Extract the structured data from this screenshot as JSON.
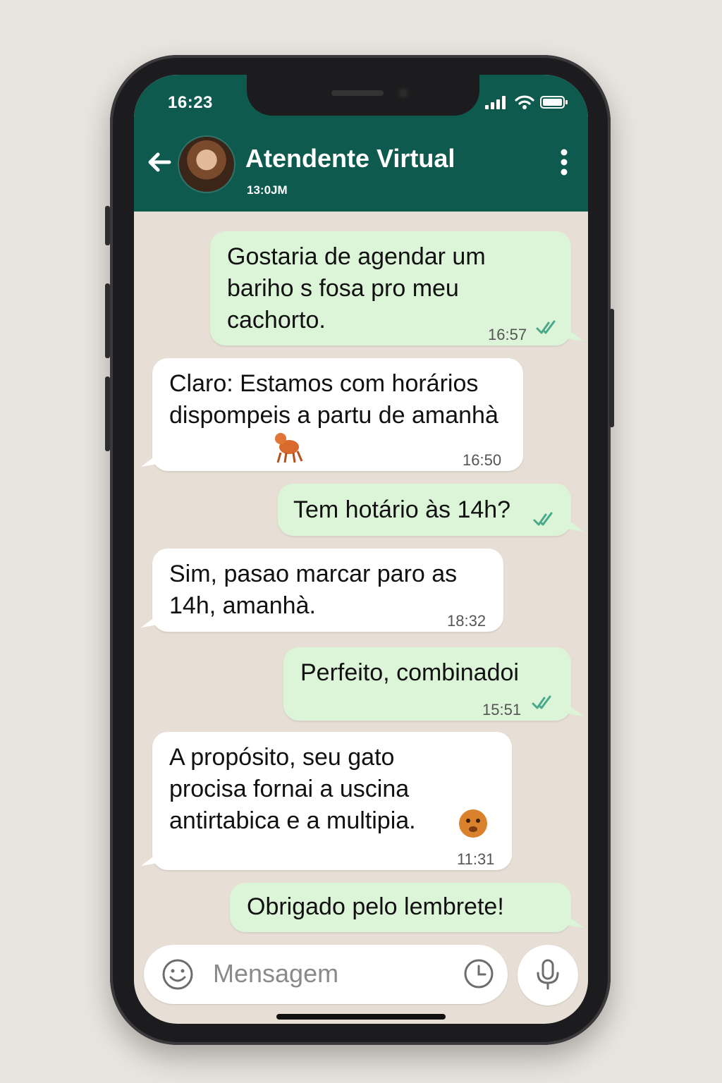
{
  "status_bar": {
    "time": "16:23"
  },
  "header": {
    "contact_name": "Atendente Virtual",
    "contact_status": "13:0JM"
  },
  "messages": [
    {
      "direction": "out",
      "text": "Gostaria de agendar um bariho s fosa pro meu cachorto.",
      "time": "16:57"
    },
    {
      "direction": "in",
      "text": "Claro: Estamos com horários dispompeis a partu de amanhà",
      "time": "16:50"
    },
    {
      "direction": "out",
      "text": "Tem hotário às 14h?",
      "time": ""
    },
    {
      "direction": "in",
      "text": "Sim, pasao marcar paro as 14h, amanhà.",
      "time": "18:32"
    },
    {
      "direction": "out",
      "text": "Perfeito, combinadoi",
      "time": "15:51"
    },
    {
      "direction": "in",
      "text": "A propósito, seu gato procisa fornai a uscina antirtabica e a multipia.",
      "time": "11:31"
    },
    {
      "direction": "out",
      "text": "Obrigado pelo lembrete!",
      "time": ""
    }
  ],
  "composer": {
    "placeholder": "Mensagem"
  },
  "colors": {
    "header": "#0e5a4f",
    "outgoing_bubble": "#dcf5d8",
    "incoming_bubble": "#ffffff",
    "chat_background": "#e7dfd5"
  },
  "icons": [
    "back-arrow-icon",
    "more-vertical-icon",
    "emoji-icon",
    "clock-icon",
    "microphone-icon",
    "read-receipt-icon",
    "signal-icon",
    "wifi-icon",
    "battery-icon"
  ]
}
